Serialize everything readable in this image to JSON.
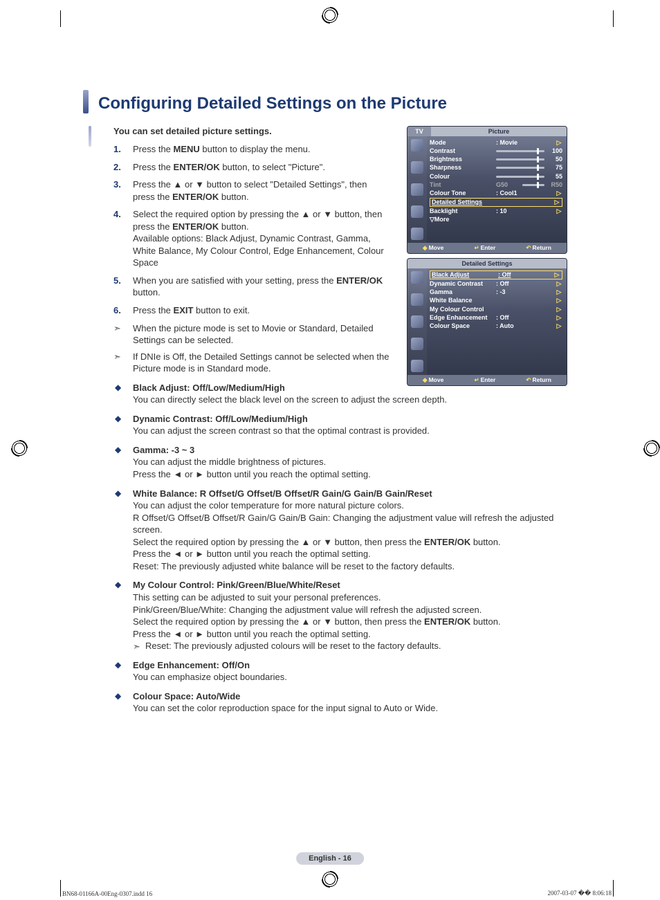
{
  "title": "Configuring Detailed Settings on the Picture",
  "intro": "You can set detailed picture settings.",
  "steps_html": [
    "Press the <b>MENU</b> button to display the menu.",
    "Press the <b>ENTER/OK</b> button, to select \"Picture\".",
    "Press the ▲ or ▼ button to select \"Detailed Settings\", then press the <b>ENTER/OK</b> button.",
    "Select the required option by pressing the ▲ or ▼ button, then press the <b>ENTER/OK</b> button.<br>Available options: Black Adjust, Dynamic Contrast, Gamma, White Balance, My Colour Control, Edge Enhancement, Colour Space",
    "When you are satisfied with your setting, press the <b>ENTER/OK</b> button.",
    "Press the <b>EXIT</b> button to exit."
  ],
  "notes": [
    "When the picture mode is set to Movie or Standard, Detailed Settings can be selected.",
    "If DNIe is Off, the Detailed Settings cannot be selected when the Picture mode is in Standard mode."
  ],
  "bullets_html": [
    "<span class='bhead'>Black Adjust: Off/Low/Medium/High</span><br>You can directly select the black level on the screen to adjust the screen depth.",
    "<span class='bhead'>Dynamic Contrast: Off/Low/Medium/High</span><br>You can adjust the screen contrast so that the optimal contrast is provided.",
    "<span class='bhead'>Gamma: -3 ~ 3</span><br>You can adjust the middle brightness of pictures.<br>Press the ◄ or ► button until you reach the optimal setting.",
    "<span class='bhead'>White Balance: R Offset/G Offset/B Offset/R Gain/G Gain/B Gain/Reset</span><br>You can adjust the color temperature for more natural picture colors.<br>R Offset/G Offset/B Offset/R Gain/G Gain/B Gain: Changing the adjustment value will refresh the adjusted screen.<br>Select the required option by pressing the ▲ or ▼ button, then press the <b>ENTER/OK</b> button.<br>Press the ◄ or ► button until you reach the optimal setting.<br>Reset: The previously adjusted white balance will be reset to the factory defaults.",
    "<span class='bhead'>My Colour Control: Pink/Green/Blue/White/Reset</span><br>This setting can be adjusted to suit your personal preferences.<br>Pink/Green/Blue/White: Changing the adjustment value will refresh the adjusted screen.<br>Select the required option by pressing the ▲ or ▼ button, then press the <b>ENTER/OK</b> button.<br>Press the ◄ or ► button until you reach the optimal setting.<br><span class='sub-note'>Reset: The previously adjusted colours will be reset to the factory defaults.</span>",
    "<span class='bhead'>Edge Enhancement: Off/On</span><br>You can emphasize object boundaries.",
    "<span class='bhead'>Colour Space: Auto/Wide</span><br>You can set the color reproduction space for the input signal to Auto or Wide."
  ],
  "osd1": {
    "tv": "TV",
    "title": "Picture",
    "rows": [
      {
        "label": "Mode",
        "value": ": Movie",
        "type": "sel"
      },
      {
        "label": "Contrast",
        "num": "100",
        "type": "slider"
      },
      {
        "label": "Brightness",
        "num": "50",
        "type": "slider"
      },
      {
        "label": "Sharpness",
        "num": "75",
        "type": "slider"
      },
      {
        "label": "Colour",
        "num": "55",
        "type": "slider"
      },
      {
        "label": "Tint",
        "value": "G50",
        "num": "R50",
        "type": "dim"
      },
      {
        "label": "Colour Tone",
        "value": ": Cool1",
        "type": "sel"
      },
      {
        "label": "Detailed Settings",
        "value": "",
        "type": "hl"
      },
      {
        "label": "Backlight",
        "value": ": 10",
        "type": "sel"
      },
      {
        "label": "▽More",
        "value": "",
        "type": "plain"
      }
    ],
    "foot": {
      "move": "Move",
      "enter": "Enter",
      "return": "Return"
    }
  },
  "osd2": {
    "title": "Detailed Settings",
    "rows": [
      {
        "label": "Black Adjust",
        "value": ": Off",
        "type": "hl"
      },
      {
        "label": "Dynamic Contrast",
        "value": ": Off",
        "type": "sel"
      },
      {
        "label": "Gamma",
        "value": ": -3",
        "type": "sel"
      },
      {
        "label": "White Balance",
        "value": "",
        "type": "sel"
      },
      {
        "label": "My Colour Control",
        "value": "",
        "type": "sel"
      },
      {
        "label": "Edge Enhancement",
        "value": ": Off",
        "type": "sel"
      },
      {
        "label": "Colour Space",
        "value": ": Auto",
        "type": "sel"
      }
    ],
    "foot": {
      "move": "Move",
      "enter": "Enter",
      "return": "Return"
    }
  },
  "footer": "English - 16",
  "doc_footer_left": "BN68-01166A-00Eng-0307.indd   16",
  "doc_footer_right": "2007-03-07   �� 8:06:18"
}
